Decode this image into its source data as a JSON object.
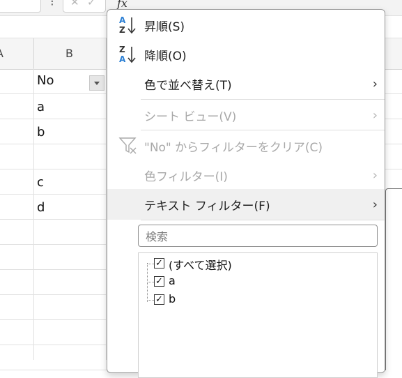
{
  "formula_bar": {
    "cancel_icon": "✕",
    "enter_icon": "✓",
    "fx_label": "fx"
  },
  "columns": [
    "A",
    "B"
  ],
  "cells": {
    "header_value": "No",
    "rows": [
      "a",
      "b",
      "",
      "c",
      "d",
      "",
      "",
      "",
      "",
      "",
      ""
    ]
  },
  "menu": {
    "sort_asc": "昇順(S)",
    "sort_desc": "降順(O)",
    "sort_by_color": "色で並べ替え(T)",
    "sheet_view": "シート ビュー(V)",
    "clear_filter": "\"No\" からフィルターをクリア(C)",
    "color_filter": "色フィルター(I)",
    "text_filter": "テキスト フィルター(F)",
    "search_placeholder": "検索",
    "tree": [
      "(すべて選択)",
      "a",
      "b"
    ]
  },
  "colors": {
    "accent_blue": "#2b7fd4",
    "disabled_text": "#a8a8a8"
  }
}
